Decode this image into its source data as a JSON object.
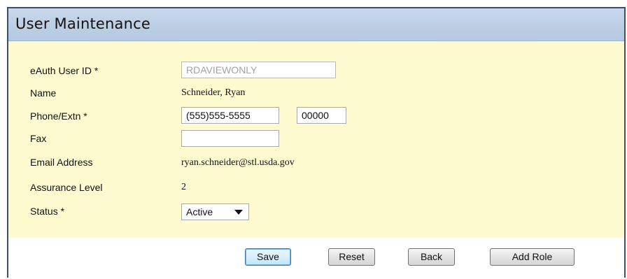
{
  "header": {
    "title": "User Maintenance"
  },
  "form": {
    "eauth_label": "eAuth User ID *",
    "eauth_value": "RDAVIEWONLY",
    "name_label": "Name",
    "name_value": "Schneider, Ryan",
    "phone_label": "Phone/Extn *",
    "phone_value": "(555)555-5555",
    "extn_value": "00000",
    "fax_label": "Fax",
    "fax_value": "",
    "email_label": "Email Address",
    "email_value": "ryan.schneider@stl.usda.gov",
    "assurance_label": "Assurance Level",
    "assurance_value": "2",
    "status_label": "Status *",
    "status_selected": "Active"
  },
  "buttons": {
    "save": "Save",
    "reset": "Reset",
    "back": "Back",
    "add_role": "Add Role"
  },
  "colors": {
    "title_bar": "#b4c8e0",
    "form_background": "#fdfbcf",
    "panel_border": "#3c4f6a"
  }
}
